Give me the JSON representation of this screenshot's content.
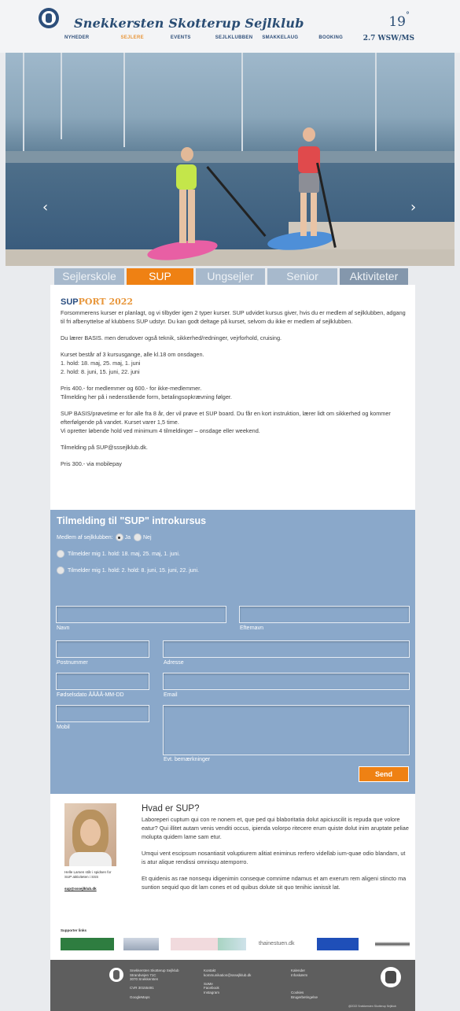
{
  "header": {
    "club_name": "Snekkersten Skotterup Sejlklub",
    "nav": [
      "NYHEDER",
      "SEJLERE",
      "EVENTS",
      "SEJLKLUBBEN",
      "SMAKKELAUG",
      "BOOKING"
    ],
    "active_nav": "SEJLERE",
    "temperature": "19",
    "temperature_unit": "°",
    "wind": "2.7 WSW/MS"
  },
  "hero": {
    "prev_arrow": "‹",
    "next_arrow": "›"
  },
  "tabs": [
    "Sejlerskole",
    "SUP",
    "Ungsejler",
    "Senior",
    "Aktiviteter"
  ],
  "active_tab": "SUP",
  "page": {
    "title_highlight": "SUP",
    "title_rest": "PORT 2022",
    "paragraphs": [
      "Forsommerens kurser er planlagt, og vi tilbyder igen 2 typer kurser. SUP udvidet kursus giver, hvis du er medlem af sejlklubben, adgang til fri afbenyttelse af klubbens SUP udstyr. Du kan godt deltage på kurset, selvom du ikke er medlem af sejlklubben.",
      "Du lærer BASIS. men derudover også teknik, sikkerhed/redninger, vejrforhold, cruising.",
      "Kurset består af 3 kursusgange, alle kl.18 om onsdagen.\n1. hold: 18. maj, 25. maj, 1. juni\n2. hold: 8. juni, 15. juni, 22. juni",
      "Pris 400.- for medlemmer og 600.- for ikke-medlemmer.\nTilmelding her på i nedenstående form, betalingsopkrævning følger.",
      "SUP BASIS/prøvetime er for alle fra 8 år, der vil prøve et SUP board. Du får en kort instruktion, lærer lidt om sikkerhed og kommer efterfølgende på vandet. Kurset varer 1,5 time.\nVi opretter løbende hold ved minimum 4 tilmeldinger – onsdage eller weekend.",
      "Tilmelding på SUP@sssejlklub.dk.",
      "Pris 300.- via mobilepay"
    ]
  },
  "form": {
    "title": "Tilmelding til \"SUP\" introkursus",
    "member_label": "Medlem af sejlklubben:",
    "yes": "Ja",
    "no": "Nej",
    "option1": "Tilmelder mig 1. hold: 18. maj, 25. maj, 1. juni.",
    "option2": "Tilmelder mig 1. hold: 2. hold: 8. juni, 15. juni, 22. juni.",
    "labels": {
      "name": "Navn",
      "lastname": "Efternavn",
      "postal": "Postnummer",
      "address": "Adresse",
      "birthdate": "Fødselsdato ÅÅÅÅ-MM-DD",
      "email": "Email",
      "mobile": "Mobil",
      "notes": "Evt. bemærkninger"
    },
    "send": "Send"
  },
  "info": {
    "caption": "Helle Larsen står i spidsen for\nSUP aktiviteten i SSS",
    "email": "sup@sssejlklub.dk",
    "heading": "Hvad er SUP?",
    "paragraphs": [
      "Laboreperi cuptum qui con re nonem et, que ped qui blaboritatia dolut apiciuscilit is repuda que volore eatur? Qui illitet autam venis venditi occus, ipienda volorpo ritecere erum quiste dolut inim aruptate peliae molupta quidem lame sam etur.",
      "Umqui vent escipsum nosantiasit voluptiurem alitiat eniminus rerfero videllab ium-quae odio blandam, ut is atur alique rendissi omnisqu atemporro.",
      " Et quidenis as rae nonsequ idigenimin conseque comnime ndamus et am exerum rem aligeni stincto ma suntion sequid quo dit lam cones et od quibus dolute sit quo tenihic ianissit lat."
    ],
    "supporters_label": "Supporter links",
    "supporter_text": "thainestuen.dk"
  },
  "footer": {
    "col1": "Snekkersten Skotterup Sejlklub\nStrandvejen 71C\n3070 Snekkersten\n\nCVR 30155491\n\nGoogleMaps",
    "col2": "Kontakt\nkommunikation@sssejlklub.dk\n\nSoMe\nFacebook\nInstagram",
    "col3": "Kalender\nInfoskærm\n\n\n\nCookies\nBrugerbetingelse",
    "copyright": "@2022 Snekkersten Skotterup Sejlklub"
  }
}
